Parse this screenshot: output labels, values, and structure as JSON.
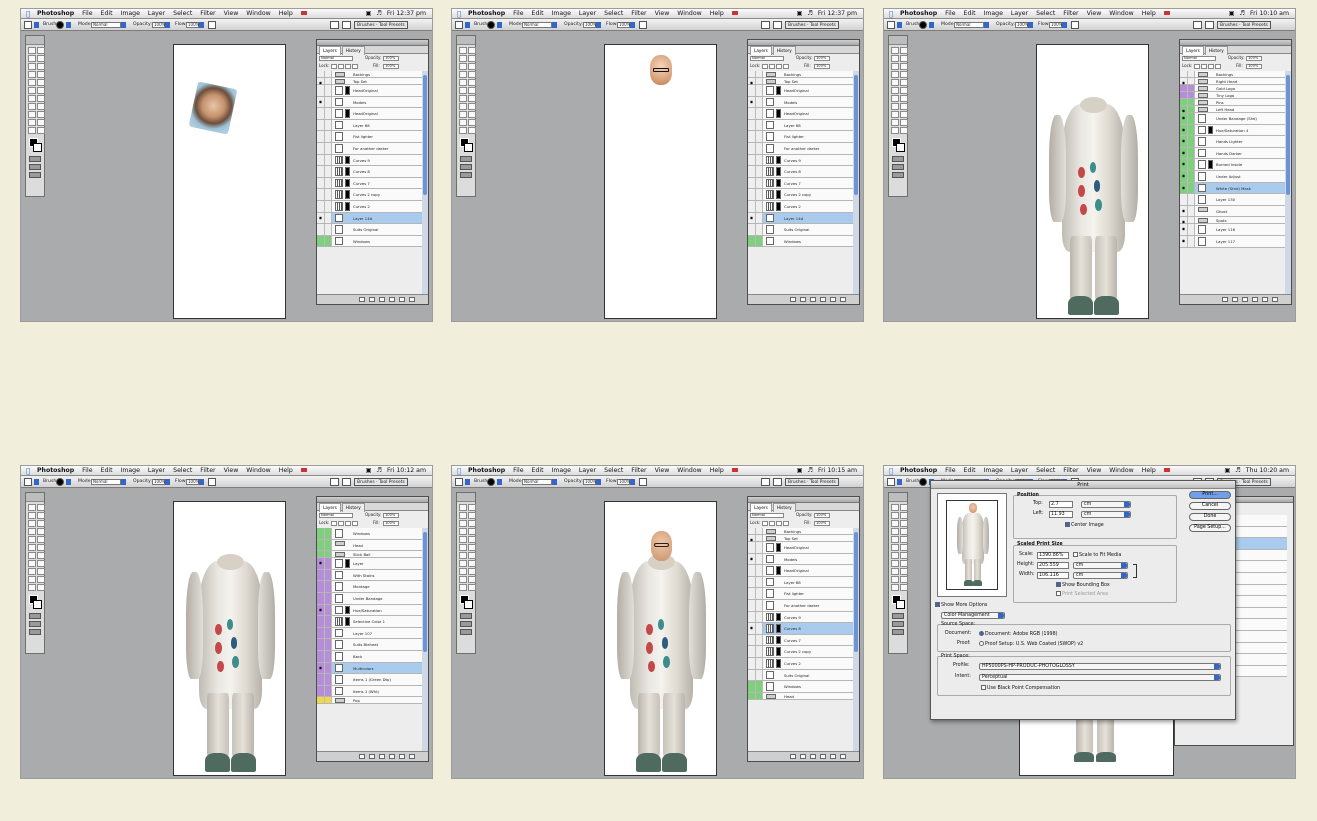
{
  "menubar": {
    "items": [
      "Photoshop",
      "File",
      "Edit",
      "Image",
      "Layer",
      "Select",
      "Filter",
      "View",
      "Window",
      "Help"
    ],
    "times": [
      "Fri 12:37 pm",
      "Fri 12:37 pm",
      "Fri 10:10 am",
      "Fri 10:12 am",
      "Fri 10:15 am",
      "Thu 10:20 am"
    ]
  },
  "options": {
    "brush_label": "Brush:",
    "mode_label": "Mode:",
    "mode_value": "Normal",
    "opacity_label": "Opacity:",
    "opacity_value": "100%",
    "flow_label": "Flow:",
    "flow_value": "100%",
    "brushes_label": "Brushes",
    "tool_presets_label": "Tool Presets"
  },
  "panel": {
    "tabs": [
      "Layers",
      "History"
    ],
    "blend": "Normal",
    "opacity_label": "Opacity:",
    "opacity_value": "100%",
    "lock_label": "Lock:",
    "fill_label": "Fill:",
    "fill_value": "100%"
  },
  "screens": [
    {
      "layers": [
        {
          "name": "Backings",
          "kind": "group",
          "short": true,
          "eye": false
        },
        {
          "name": "Top Set",
          "kind": "group",
          "short": true,
          "eye": true
        },
        {
          "name": "HeadOriginal",
          "kind": "mask",
          "eye": false
        },
        {
          "name": "Models",
          "kind": "plain",
          "eye": true
        },
        {
          "name": "HeadOriginal",
          "kind": "mask",
          "eye": false
        },
        {
          "name": "Layer 68",
          "kind": "plain",
          "eye": false
        },
        {
          "name": "Fist lighter",
          "kind": "plain",
          "eye": false
        },
        {
          "name": "For another darker",
          "kind": "plain",
          "eye": false
        },
        {
          "name": "Curves 9",
          "kind": "adj",
          "eye": false
        },
        {
          "name": "Curves 8",
          "kind": "adj",
          "eye": false
        },
        {
          "name": "Curves 7",
          "kind": "adj",
          "eye": false
        },
        {
          "name": "Curves 2 copy",
          "kind": "adj",
          "eye": false
        },
        {
          "name": "Curves 2",
          "kind": "adj",
          "eye": false
        },
        {
          "name": "Layer 14d",
          "kind": "plain",
          "sel": true,
          "eye": true
        },
        {
          "name": "Suits Original",
          "kind": "plain",
          "eye": false
        },
        {
          "name": "Windows",
          "kind": "plain",
          "color": "green",
          "eye": false
        }
      ]
    },
    {
      "layers": [
        {
          "name": "Backings",
          "kind": "group",
          "short": true,
          "eye": false
        },
        {
          "name": "Top Set",
          "kind": "group",
          "short": true,
          "eye": true
        },
        {
          "name": "HeadOriginal",
          "kind": "mask",
          "eye": false
        },
        {
          "name": "Models",
          "kind": "plain",
          "eye": true
        },
        {
          "name": "HeadOriginal",
          "kind": "mask",
          "eye": false
        },
        {
          "name": "Layer 68",
          "kind": "plain",
          "eye": false
        },
        {
          "name": "Fist lighter",
          "kind": "plain",
          "eye": false
        },
        {
          "name": "For another darker",
          "kind": "plain",
          "eye": false
        },
        {
          "name": "Curves 9",
          "kind": "adj",
          "eye": false
        },
        {
          "name": "Curves 8",
          "kind": "adj",
          "eye": false
        },
        {
          "name": "Curves 7",
          "kind": "adj",
          "eye": false
        },
        {
          "name": "Curves 2 copy",
          "kind": "adj",
          "eye": false
        },
        {
          "name": "Curves 2",
          "kind": "adj",
          "eye": false
        },
        {
          "name": "Layer 14d",
          "kind": "plain",
          "sel": true,
          "eye": true
        },
        {
          "name": "Suits Original",
          "kind": "plain",
          "eye": false
        },
        {
          "name": "Windows",
          "kind": "plain",
          "color": "green",
          "eye": false
        }
      ]
    },
    {
      "layers": [
        {
          "name": "Backings",
          "kind": "group",
          "short": true,
          "eye": false
        },
        {
          "name": "Right Head",
          "kind": "group",
          "short": true,
          "eye": true
        },
        {
          "name": "Gold Logo",
          "kind": "group",
          "short": true,
          "eye": false,
          "color": "violet"
        },
        {
          "name": "Tiny Logo",
          "kind": "group",
          "short": true,
          "eye": false,
          "color": "violet"
        },
        {
          "name": "Pins",
          "kind": "group",
          "short": true,
          "eye": false,
          "color": "green"
        },
        {
          "name": "Left Head",
          "kind": "group",
          "short": true,
          "eye": true,
          "color": "green"
        },
        {
          "name": "Under Bandage (Shd)",
          "kind": "plain",
          "eye": true,
          "color": "green"
        },
        {
          "name": "Hue/Saturation 4",
          "kind": "mask",
          "eye": true,
          "color": "green"
        },
        {
          "name": "Hands Lighter",
          "kind": "plain",
          "eye": true,
          "color": "green"
        },
        {
          "name": "Hands Darker",
          "kind": "plain",
          "eye": true,
          "color": "green"
        },
        {
          "name": "Burned Inside",
          "kind": "mask",
          "eye": true,
          "color": "green"
        },
        {
          "name": "Under Adjust",
          "kind": "plain",
          "eye": true,
          "color": "green"
        },
        {
          "name": "White (Stnd) Mask",
          "kind": "plain",
          "sel": true,
          "eye": true,
          "color": "green"
        },
        {
          "name": "Layer 130",
          "kind": "plain",
          "eye": false
        },
        {
          "name": "Ghost",
          "kind": "group",
          "eye": true
        },
        {
          "name": "Spots",
          "kind": "group",
          "short": true,
          "eye": true
        },
        {
          "name": "Layer 116",
          "kind": "plain",
          "eye": true
        },
        {
          "name": "Layer 117",
          "kind": "plain",
          "eye": true
        }
      ]
    },
    {
      "layers": [
        {
          "name": "Windows",
          "kind": "plain",
          "color": "green",
          "eye": false
        },
        {
          "name": "Head",
          "kind": "group",
          "color": "green",
          "eye": false
        },
        {
          "name": "Stick Ball",
          "kind": "group",
          "short": true,
          "color": "green",
          "eye": false
        },
        {
          "name": "Layer",
          "kind": "mask",
          "color": "violet",
          "eye": true
        },
        {
          "name": "With Stains",
          "kind": "plain",
          "color": "violet",
          "eye": false
        },
        {
          "name": "Montage",
          "kind": "plain",
          "color": "violet",
          "eye": false
        },
        {
          "name": "Under Bandage",
          "kind": "plain",
          "color": "violet",
          "eye": false
        },
        {
          "name": "Hue/Saturation",
          "kind": "mask",
          "color": "violet",
          "eye": true
        },
        {
          "name": "Selective Color 1",
          "kind": "adj",
          "color": "violet",
          "eye": false
        },
        {
          "name": "Layer 107",
          "kind": "plain",
          "color": "violet",
          "eye": false
        },
        {
          "name": "Suits Bleheat",
          "kind": "plain",
          "color": "violet",
          "eye": false
        },
        {
          "name": "Back",
          "kind": "plain",
          "color": "violet",
          "eye": false
        },
        {
          "name": "Multicolors",
          "kind": "plain",
          "sel": true,
          "color": "violet",
          "eye": true
        },
        {
          "name": "Items 1 (Green Dtp)",
          "kind": "plain",
          "color": "violet",
          "eye": false
        },
        {
          "name": "Items 1 (Wht)",
          "kind": "plain",
          "color": "violet",
          "eye": false
        },
        {
          "name": "Pop",
          "kind": "group",
          "short": true,
          "color": "yellow",
          "eye": false
        }
      ]
    },
    {
      "layers": [
        {
          "name": "Backings",
          "kind": "group",
          "short": true,
          "eye": false
        },
        {
          "name": "Top Set",
          "kind": "group",
          "short": true,
          "eye": true
        },
        {
          "name": "HeadOriginal",
          "kind": "mask",
          "eye": false
        },
        {
          "name": "Models",
          "kind": "plain",
          "eye": true
        },
        {
          "name": "HeadOriginal",
          "kind": "mask",
          "eye": false
        },
        {
          "name": "Layer 68",
          "kind": "plain",
          "eye": false
        },
        {
          "name": "Fist lighter",
          "kind": "plain",
          "eye": false
        },
        {
          "name": "For another darker",
          "kind": "plain",
          "eye": false
        },
        {
          "name": "Curves 9",
          "kind": "adj",
          "eye": false
        },
        {
          "name": "Curves 8",
          "kind": "adj",
          "sel": true,
          "eye": true
        },
        {
          "name": "Curves 7",
          "kind": "adj",
          "eye": false
        },
        {
          "name": "Curves 2 copy",
          "kind": "adj",
          "eye": false
        },
        {
          "name": "Curves 2",
          "kind": "adj",
          "eye": false
        },
        {
          "name": "Suits Original",
          "kind": "plain",
          "eye": false
        },
        {
          "name": "Windows",
          "kind": "plain",
          "color": "green",
          "eye": false
        },
        {
          "name": "Head",
          "kind": "group",
          "short": true,
          "color": "green",
          "eye": false
        }
      ]
    }
  ],
  "print_dialog": {
    "title": "Print",
    "position_label": "Position",
    "top_label": "Top:",
    "top_value": "2.7",
    "left_label": "Left:",
    "left_value": "11.93",
    "unit": "cm",
    "center_image": "Center Image",
    "scaled_label": "Scaled Print Size",
    "scale_label": "Scale:",
    "scale_value": "1390.86%",
    "scale_to_fit": "Scale to Fit Media",
    "height_label": "Height:",
    "height_value": "205.559",
    "width_label": "Width:",
    "width_value": "106.116",
    "show_bbox": "Show Bounding Box",
    "print_sel": "Print Selected Area",
    "show_more": "Show More Options",
    "color_mgmt": "Color Management",
    "source_space": "Source Space:",
    "document_label": "Document:",
    "document_value": "Document: Adobe RGB (1998)",
    "proof_label": "Proof:",
    "proof_value": "Proof Setup: U.S. Web Coated (SWOP) v2",
    "print_space": "Print Space:",
    "profile_label": "Profile:",
    "profile_value": "HP5000PS-HP-PRODUC-PHOTOGLOSSY",
    "intent_label": "Intent:",
    "intent_value": "Perceptual",
    "black_point": "Use Black Point Compensation",
    "print_btn": "Print...",
    "cancel_btn": "Cancel",
    "done_btn": "Done",
    "page_setup_btn": "Page Setup..."
  }
}
